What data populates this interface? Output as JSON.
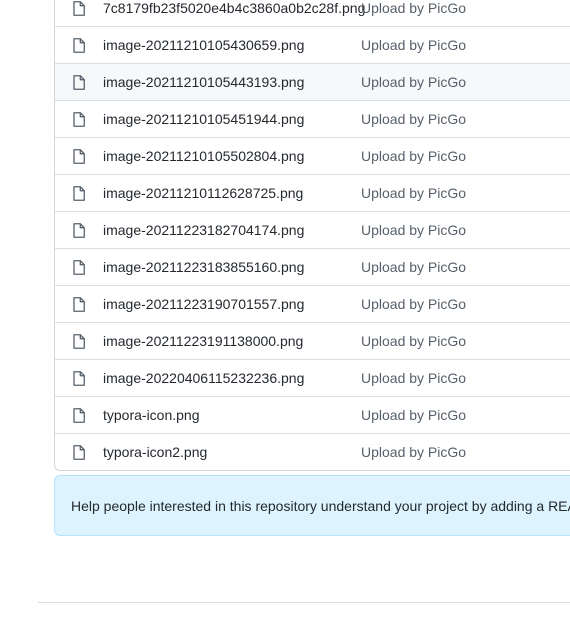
{
  "files": [
    {
      "name": "7c8179fb23f5020e4b4c3860a0b2c28f.png",
      "message": "Upload by PicGo"
    },
    {
      "name": "image-20211210105430659.png",
      "message": "Upload by PicGo"
    },
    {
      "name": "image-20211210105443193.png",
      "message": "Upload by PicGo"
    },
    {
      "name": "image-20211210105451944.png",
      "message": "Upload by PicGo"
    },
    {
      "name": "image-20211210105502804.png",
      "message": "Upload by PicGo"
    },
    {
      "name": "image-20211210112628725.png",
      "message": "Upload by PicGo"
    },
    {
      "name": "image-20211223182704174.png",
      "message": "Upload by PicGo"
    },
    {
      "name": "image-20211223183855160.png",
      "message": "Upload by PicGo"
    },
    {
      "name": "image-20211223190701557.png",
      "message": "Upload by PicGo"
    },
    {
      "name": "image-20211223191138000.png",
      "message": "Upload by PicGo"
    },
    {
      "name": "image-20220406115232236.png",
      "message": "Upload by PicGo"
    },
    {
      "name": "typora-icon.png",
      "message": "Upload by PicGo"
    },
    {
      "name": "typora-icon2.png",
      "message": "Upload by PicGo"
    }
  ],
  "readme_banner": {
    "text": "Help people interested in this repository understand your project by adding a README."
  },
  "icons": {
    "file": "file-icon"
  },
  "colors": {
    "banner_bg": "#ddf4ff",
    "banner_border": "#b6e3ff",
    "row_border": "#d8dee4",
    "hover_row": "#f6f8fa",
    "message_text": "#57606a"
  }
}
